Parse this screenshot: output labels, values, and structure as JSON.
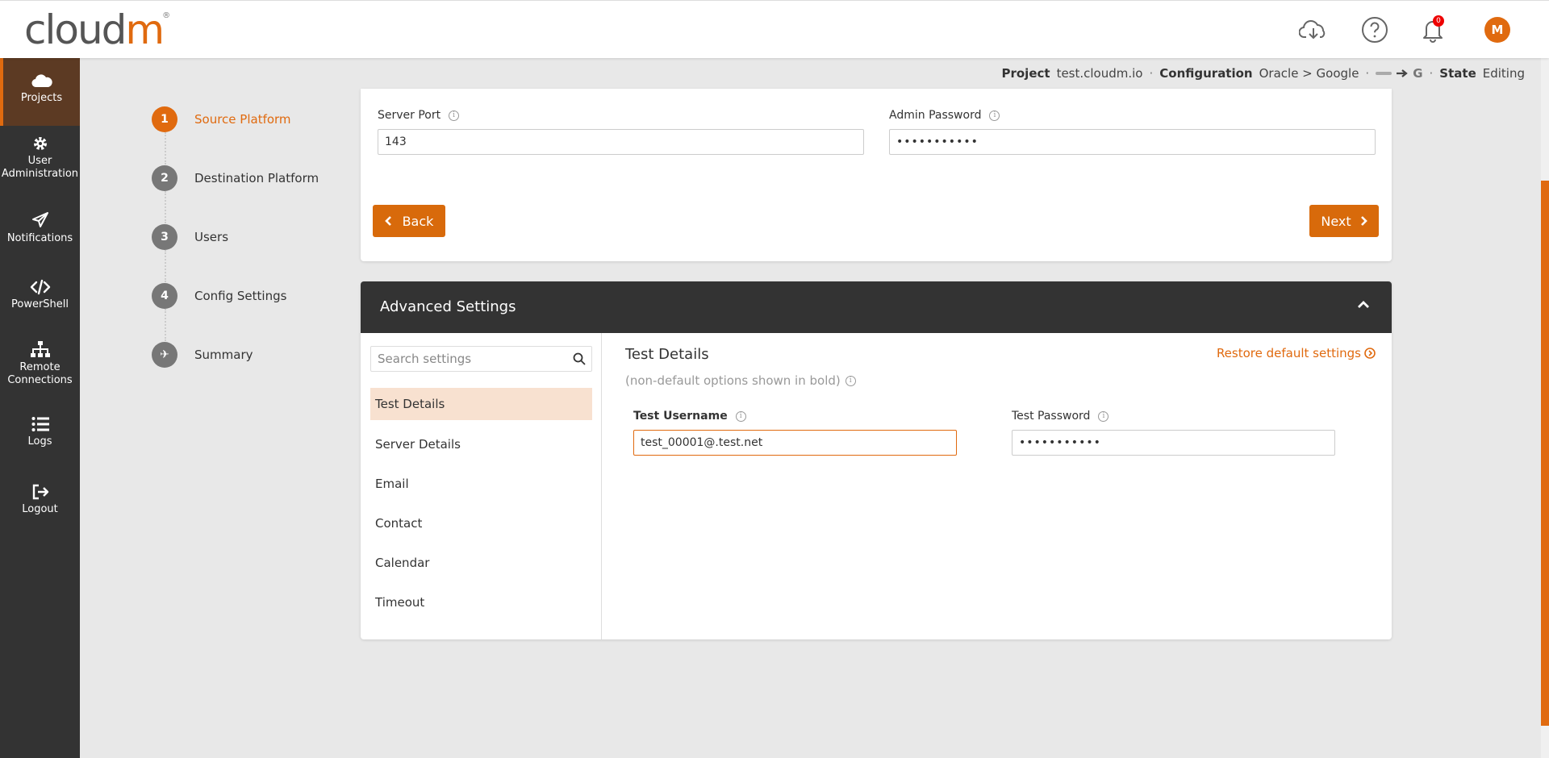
{
  "header": {
    "logo_cloud": "cloud",
    "logo_m": "m",
    "logo_reg": "®",
    "icons": [
      "cloud-download-icon",
      "help-icon",
      "bell-icon"
    ],
    "notification_count": "0",
    "avatar_initial": "M"
  },
  "sidebar": {
    "items": [
      {
        "label": "Projects",
        "icon": "cloud-icon"
      },
      {
        "label": "User Administration",
        "icon": "gear-icon"
      },
      {
        "label": "Notifications",
        "icon": "paper-plane-icon"
      },
      {
        "label": "PowerShell",
        "icon": "code-icon"
      },
      {
        "label": "Remote Connections",
        "icon": "sitemap-icon"
      },
      {
        "label": "Logs",
        "icon": "list-icon"
      },
      {
        "label": "Logout",
        "icon": "logout-icon"
      }
    ]
  },
  "infobar": {
    "project_key": "Project",
    "project_value": "test.cloudm.io",
    "config_key": "Configuration",
    "config_value": "Oracle > Google",
    "google_letter": "G",
    "state_key": "State",
    "state_value": "Editing",
    "separator": "·"
  },
  "stepper": {
    "steps": [
      {
        "num": "1",
        "label": "Source Platform"
      },
      {
        "num": "2",
        "label": "Destination Platform"
      },
      {
        "num": "3",
        "label": "Users"
      },
      {
        "num": "4",
        "label": "Config Settings"
      },
      {
        "num": "✈",
        "label": "Summary"
      }
    ]
  },
  "top_card": {
    "server_port_label": "Server Port",
    "server_port_value": "143",
    "admin_password_label": "Admin Password",
    "admin_password_value": "•••••••••••",
    "back_label": "Back",
    "next_label": "Next"
  },
  "advanced": {
    "title": "Advanced Settings",
    "search_placeholder": "Search settings",
    "menu": [
      "Test Details",
      "Server Details",
      "Email",
      "Contact",
      "Calendar",
      "Timeout"
    ],
    "section_title": "Test Details",
    "restore_label": "Restore default settings",
    "note": "(non-default options shown in bold)",
    "username_label": "Test Username",
    "username_value": "test_00001@.test.net",
    "password_label": "Test Password",
    "password_value": "•••••••••••"
  },
  "colors": {
    "accent": "#e06a0f",
    "sidebar_bg": "#333333",
    "active_menu_bg": "#f8e1d0"
  }
}
